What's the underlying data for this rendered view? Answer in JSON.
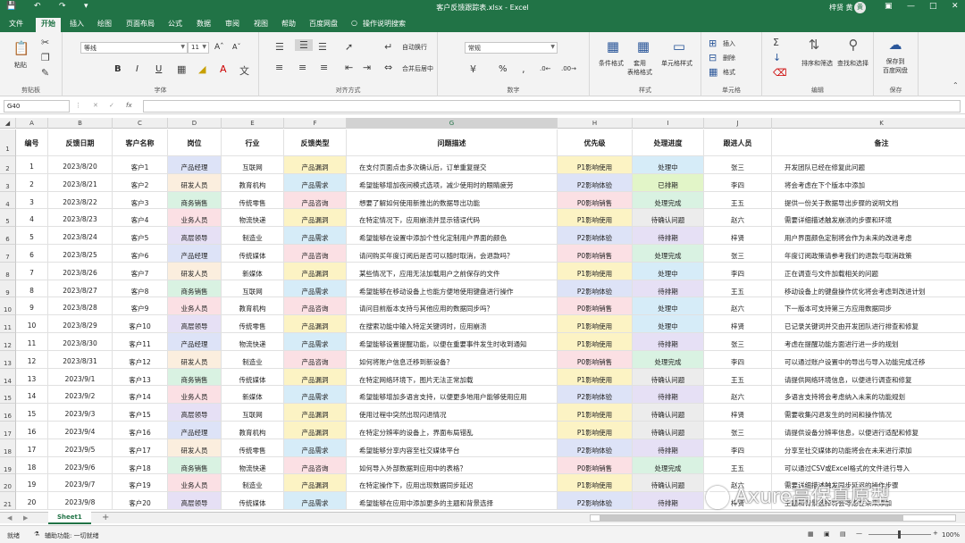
{
  "title_bar": {
    "file_title": "客户反馈跟踪表.xlsx - Excel",
    "user_name": "梓贤 黄",
    "avatar": "黄",
    "qa_icons": [
      "save-icon",
      "undo-icon",
      "redo-icon",
      "customize-icon"
    ],
    "window_controls": [
      "ribbon-options-icon",
      "minimize-icon",
      "restore-icon",
      "close-icon"
    ]
  },
  "menu": {
    "tabs": [
      "文件",
      "开始",
      "插入",
      "绘图",
      "页面布局",
      "公式",
      "数据",
      "审阅",
      "视图",
      "帮助",
      "百度网盘",
      "操作说明搜索"
    ],
    "active": "开始"
  },
  "ribbon": {
    "clipboard": {
      "label": "剪贴板",
      "paste": "粘贴"
    },
    "font": {
      "label": "字体",
      "font_name": "等线",
      "font_size": "11",
      "bold": "B",
      "italic": "I",
      "underline": "U"
    },
    "alignment": {
      "label": "对齐方式",
      "wrap": "自动换行",
      "merge": "合并后居中"
    },
    "number": {
      "label": "数字",
      "format": "常规",
      "percent": "%"
    },
    "styles": {
      "label": "样式",
      "conditional": "条件格式",
      "table": "套用\n表格格式",
      "cell_styles": "单元格样式"
    },
    "cells": {
      "label": "单元格",
      "insert": "插入",
      "delete": "删除",
      "format": "格式"
    },
    "editing": {
      "label": "编辑",
      "sort": "排序和筛选",
      "find": "查找和选择"
    },
    "save": {
      "label": "保存",
      "save_to": "保存到\n百度网盘"
    }
  },
  "formula_bar": {
    "name_box": "G40",
    "fx": "fx",
    "value": ""
  },
  "columns": [
    "A",
    "B",
    "C",
    "D",
    "E",
    "F",
    "G",
    "H",
    "I",
    "J",
    "K"
  ],
  "selected_column": "G",
  "headers": [
    "编号",
    "反馈日期",
    "客户名称",
    "岗位",
    "行业",
    "反馈类型",
    "问题描述",
    "优先级",
    "处理进度",
    "跟进人员",
    "备注"
  ],
  "rows": [
    [
      "1",
      "2023/8/20",
      "客户1",
      "产品经理",
      "互联网",
      "产品漏洞",
      "在支付页面点击多次确认后，订单重复提交",
      "P1影响使用",
      "处理中",
      "张三",
      "开发团队已经在修复此问题"
    ],
    [
      "2",
      "2023/8/21",
      "客户2",
      "研发人员",
      "教育机构",
      "产品需求",
      "希望能够增加夜间模式选项，减少使用时的眼睛疲劳",
      "P2影响体验",
      "已排期",
      "李四",
      "将会考虑在下个版本中添加"
    ],
    [
      "3",
      "2023/8/22",
      "客户3",
      "商务销售",
      "传统零售",
      "产品咨询",
      "想要了解如何使用新推出的数据导出功能",
      "P0影响销售",
      "处理完成",
      "王五",
      "提供一份关于数据导出步骤的说明文档"
    ],
    [
      "4",
      "2023/8/23",
      "客户4",
      "业务人员",
      "物流快递",
      "产品漏洞",
      "在特定情况下，应用崩溃并显示错误代码",
      "P1影响使用",
      "待确认问题",
      "赵六",
      "需要详细描述触发崩溃的步骤和环境"
    ],
    [
      "5",
      "2023/8/24",
      "客户5",
      "高层领导",
      "制造业",
      "产品需求",
      "希望能够在设置中添加个性化定制用户界面的颜色",
      "P2影响体验",
      "待排期",
      "梓贤",
      "用户界面颜色定制将会作为未来的改进考虑"
    ],
    [
      "6",
      "2023/8/25",
      "客户6",
      "产品经理",
      "传统媒体",
      "产品咨询",
      "请问购买年度订阅后是否可以随时取消，会退款吗？",
      "P0影响销售",
      "处理完成",
      "张三",
      "年度订阅政策请参考我们的退款与取消政策"
    ],
    [
      "7",
      "2023/8/26",
      "客户7",
      "研发人员",
      "新媒体",
      "产品漏洞",
      "某些情况下，应用无法加载用户之前保存的文件",
      "P1影响使用",
      "处理中",
      "李四",
      "正在调查与文件加载相关的问题"
    ],
    [
      "8",
      "2023/8/27",
      "客户8",
      "商务销售",
      "互联网",
      "产品需求",
      "希望能够在移动设备上也能方便地使用键盘进行操作",
      "P2影响体验",
      "待排期",
      "王五",
      "移动设备上的键盘操作优化将会考虑到改进计划"
    ],
    [
      "9",
      "2023/8/28",
      "客户9",
      "业务人员",
      "教育机构",
      "产品咨询",
      "请问目前版本支持与其他应用的数据同步吗？",
      "P0影响销售",
      "处理中",
      "赵六",
      "下一版本可支持第三方应用数据同步"
    ],
    [
      "10",
      "2023/8/29",
      "客户10",
      "高层领导",
      "传统零售",
      "产品漏洞",
      "在搜索功能中输入特定关键词时，应用崩溃",
      "P1影响使用",
      "处理中",
      "梓贤",
      "已记录关键词并交由开发团队进行排查和修复"
    ],
    [
      "11",
      "2023/8/30",
      "客户11",
      "产品经理",
      "物流快递",
      "产品需求",
      "希望能够设置提醒功能，以便在重要事件发生时收到通知",
      "P1影响使用",
      "待排期",
      "张三",
      "考虑在提醒功能方面进行进一步的规划"
    ],
    [
      "12",
      "2023/8/31",
      "客户12",
      "研发人员",
      "制造业",
      "产品咨询",
      "如何将账户信息迁移到新设备？",
      "P0影响销售",
      "处理完成",
      "李四",
      "可以通过账户设置中的导出与导入功能完成迁移"
    ],
    [
      "13",
      "2023/9/1",
      "客户13",
      "商务销售",
      "传统媒体",
      "产品漏洞",
      "在特定网络环境下，图片无法正常加载",
      "P1影响使用",
      "待确认问题",
      "王五",
      "请提供网络环境信息，以便进行调查和修复"
    ],
    [
      "14",
      "2023/9/2",
      "客户14",
      "业务人员",
      "新媒体",
      "产品需求",
      "希望能够增加多语言支持，以便更多地用户能够使用应用",
      "P2影响体验",
      "待排期",
      "赵六",
      "多语言支持将会考虑纳入未来的功能规划"
    ],
    [
      "15",
      "2023/9/3",
      "客户15",
      "高层领导",
      "互联网",
      "产品漏洞",
      "使用过程中突然出现闪退情况",
      "P1影响使用",
      "待确认问题",
      "梓贤",
      "需要收集闪退发生的时间和操作情况"
    ],
    [
      "16",
      "2023/9/4",
      "客户16",
      "产品经理",
      "教育机构",
      "产品漏洞",
      "在特定分辨率的设备上，界面布局错乱",
      "P1影响使用",
      "待确认问题",
      "张三",
      "请提供设备分辨率信息，以便进行适配和修复"
    ],
    [
      "17",
      "2023/9/5",
      "客户17",
      "研发人员",
      "传统零售",
      "产品需求",
      "希望能够分享内容至社交媒体平台",
      "P2影响体验",
      "待排期",
      "李四",
      "分享至社交媒体的功能将会在未来进行添加"
    ],
    [
      "18",
      "2023/9/6",
      "客户18",
      "商务销售",
      "物流快递",
      "产品咨询",
      "如何导入外部数据到应用中的表格？",
      "P0影响销售",
      "处理完成",
      "王五",
      "可以通过CSV或Excel格式的文件进行导入"
    ],
    [
      "19",
      "2023/9/7",
      "客户19",
      "业务人员",
      "制造业",
      "产品漏洞",
      "在特定操作下，应用出现数据同步延迟",
      "P1影响使用",
      "待确认问题",
      "赵六",
      "需要详细描述触发同步延迟的操作步骤"
    ],
    [
      "20",
      "2023/9/8",
      "客户20",
      "高层领导",
      "传统媒体",
      "产品需求",
      "希望能够在应用中添加更多的主题和背景选择",
      "P2影响体验",
      "待排期",
      "梓贤",
      "主题和背景选择将会考虑在未来添加"
    ]
  ],
  "row_numbers": [
    "1",
    "2",
    "3",
    "4",
    "5",
    "6",
    "7",
    "8",
    "9",
    "10",
    "11",
    "12",
    "13",
    "14",
    "15",
    "16",
    "17",
    "18",
    "19",
    "20",
    "21"
  ],
  "tag_colors": {
    "产品经理": "#dde3f7",
    "研发人员": "#fbeede",
    "商务销售": "#d9f2e2",
    "业务人员": "#fbe0e4",
    "高层领导": "#e6e0f5",
    "产品漏洞": "#fcf3c4",
    "产品需求": "#d6ecf8",
    "产品咨询": "#fbe0e4",
    "P1影响使用": "#fcf3c4",
    "P2影响体验": "#dde3f7",
    "P0影响销售": "#fbe0e4",
    "处理中": "#d6ecf8",
    "已排期": "#e2f5c8",
    "处理完成": "#d9f2e2",
    "待确认问题": "#ececec",
    "待排期": "#e6e0f5"
  },
  "sheet_tab": "Sheet1",
  "add_sheet": "+",
  "status": {
    "ready": "就绪",
    "accessibility": "辅助功能: 一切就绪",
    "zoom": "100%"
  },
  "watermark": "Axure高保真原型"
}
